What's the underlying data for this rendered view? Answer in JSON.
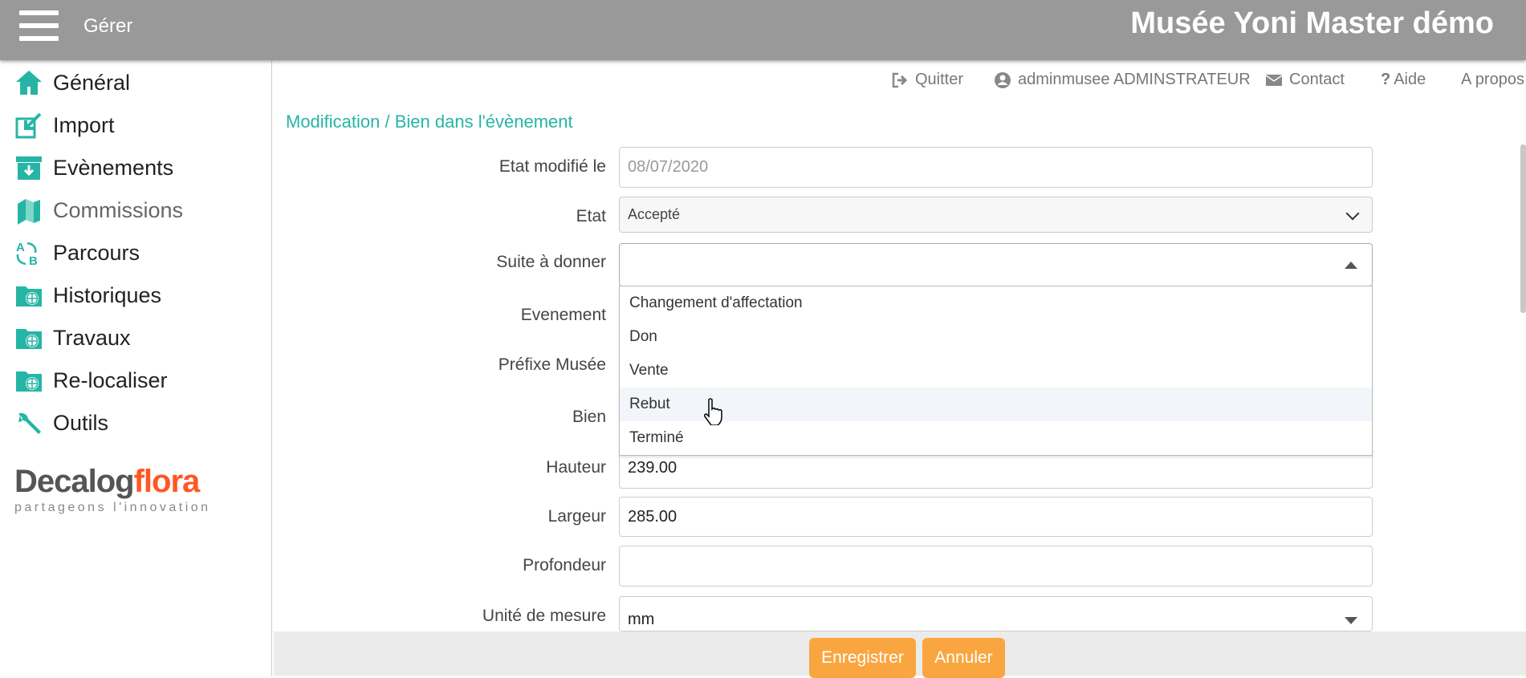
{
  "header": {
    "menu_label": "Gérer",
    "app_title": "Musée Yoni Master démo"
  },
  "sidebar": {
    "items": [
      {
        "label": "Général",
        "icon": "home-icon"
      },
      {
        "label": "Import",
        "icon": "import-icon"
      },
      {
        "label": "Evènements",
        "icon": "archive-icon"
      },
      {
        "label": "Commissions",
        "icon": "books-icon"
      },
      {
        "label": "Parcours",
        "icon": "route-icon"
      },
      {
        "label": "Historiques",
        "icon": "folder-globe-icon"
      },
      {
        "label": "Travaux",
        "icon": "folder-globe-icon"
      },
      {
        "label": "Re-localiser",
        "icon": "folder-globe-icon"
      },
      {
        "label": "Outils",
        "icon": "wrench-icon"
      }
    ],
    "logo": {
      "brand_a": "Decalog",
      "brand_b": "flora",
      "tagline": "partageons l'innovation"
    }
  },
  "topnav": {
    "quit": "Quitter",
    "user": "adminmusee ADMINSTRATEUR",
    "contact": "Contact",
    "help": "Aide",
    "about": "A propos"
  },
  "breadcrumb": "Modification / Bien dans l'évènement",
  "form": {
    "etat_modifie_label": "Etat modifié le",
    "etat_modifie_value": "08/07/2020",
    "etat_label": "Etat",
    "etat_value": "Accepté",
    "suite_label": "Suite à donner",
    "suite_value": "",
    "evenement_label": "Evenement",
    "prefixe_label": "Préfixe Musée",
    "bien_label": "Bien",
    "hauteur_label": "Hauteur",
    "hauteur_value": "239.00",
    "largeur_label": "Largeur",
    "largeur_value": "285.00",
    "profondeur_label": "Profondeur",
    "profondeur_value": "",
    "unite_label": "Unité de mesure",
    "unite_value": "mm"
  },
  "dropdown": {
    "options": [
      "Changement d'affectation",
      "Don",
      "Vente",
      "Rebut",
      "Terminé"
    ],
    "hovered": "Rebut"
  },
  "actions": {
    "save": "Enregistrer",
    "cancel": "Annuler"
  },
  "colors": {
    "accent": "#26b5a5",
    "button": "#f9a640",
    "header": "#999999",
    "brand_orange": "#ff5722"
  }
}
